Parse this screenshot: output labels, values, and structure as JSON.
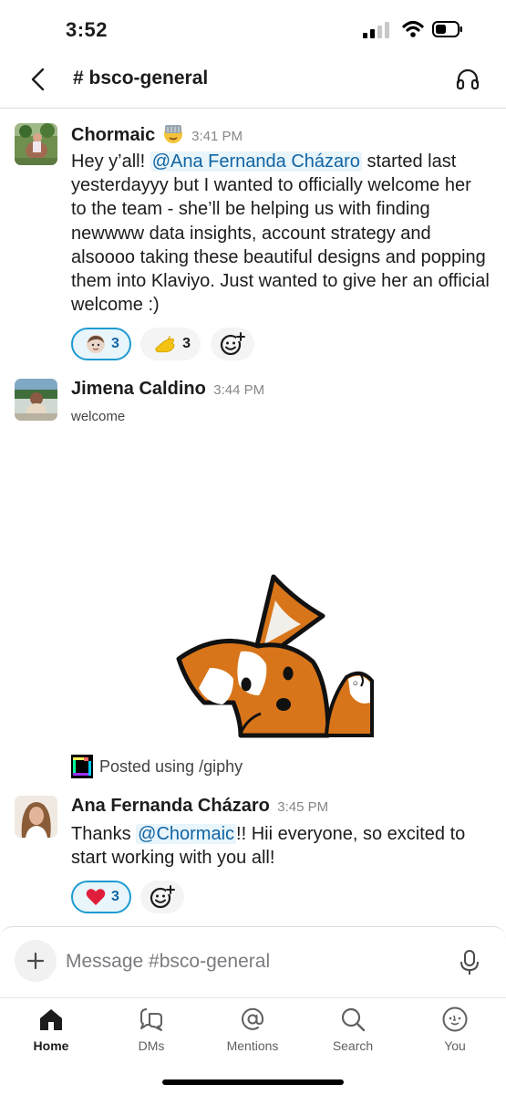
{
  "status_bar": {
    "time": "3:52"
  },
  "header": {
    "channel": "# bsco-general"
  },
  "messages": [
    {
      "author": "Chormaic",
      "time": "3:41 PM",
      "text_before": "Hey y’all! ",
      "mention": "@Ana Fernanda Cházaro",
      "text_after": " started last yesterdayyy but I wanted to officially welcome her to the team - she’ll be helping us with finding newwww data insights, account strategy and alsoooo taking these beautiful designs and popping them into Klaviyo. Just wanted to give her an official welcome :)",
      "reactions": [
        {
          "emoji": "avatar-emoji",
          "count": "3"
        },
        {
          "emoji": "hand-emoji",
          "count": "3"
        }
      ]
    },
    {
      "author": "Jimena Caldino",
      "time": "3:44 PM",
      "text": "welcome",
      "attachment": "Posted using /giphy"
    },
    {
      "author": "Ana Fernanda Cházaro",
      "time": "3:45 PM",
      "text_before": "Thanks ",
      "mention": "@Chormaic",
      "text_after": "!! Hii everyone, so excited to start working with you all!",
      "reactions": [
        {
          "emoji": "❤️",
          "count": "3"
        }
      ]
    }
  ],
  "composer": {
    "placeholder": "Message #bsco-general"
  },
  "tabs": [
    {
      "label": "Home",
      "icon": "home-icon"
    },
    {
      "label": "DMs",
      "icon": "dms-icon"
    },
    {
      "label": "Mentions",
      "icon": "mentions-icon"
    },
    {
      "label": "Search",
      "icon": "search-icon"
    },
    {
      "label": "You",
      "icon": "you-icon"
    }
  ],
  "colors": {
    "mention": "#1264a3",
    "reaction_border": "#1d9bd1",
    "heart": "#e01e3c"
  }
}
